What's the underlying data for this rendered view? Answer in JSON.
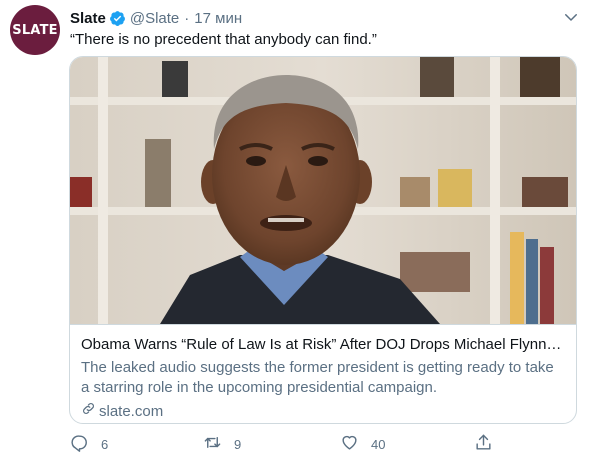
{
  "account": {
    "avatar_text": "SLATE",
    "avatar_color": "#6b1d3e",
    "display_name": "Slate",
    "handle": "@Slate",
    "separator": "·",
    "time": "17 мин",
    "verified": true
  },
  "tweet": {
    "text": "“There is no precedent that anybody can find.”"
  },
  "card": {
    "title": "Obama Warns “Rule of Law Is at Risk” After DOJ Drops Michael Flynn Ca...",
    "description": "The leaked audio suggests the former president is getting ready to take a starring role in the upcoming presidential campaign.",
    "domain": "slate.com",
    "image_icon": "portrait-photo"
  },
  "actions": {
    "reply_count": "6",
    "retweet_count": "9",
    "like_count": "40"
  },
  "colors": {
    "text_primary": "#0f1419",
    "text_secondary": "#5b7083",
    "verified_blue": "#1da1f2",
    "border": "#cfd9de"
  }
}
